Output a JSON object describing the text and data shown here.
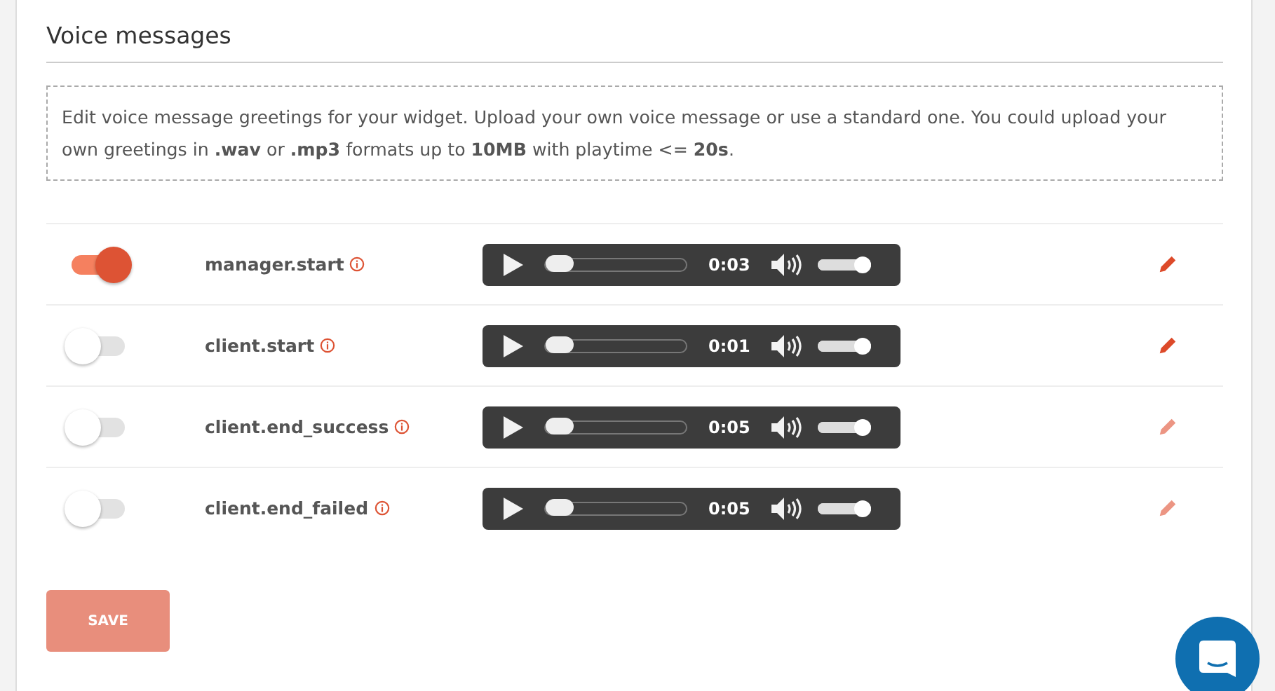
{
  "section": {
    "title": "Voice messages"
  },
  "notice": "Edit voice message greetings for your widget. Upload your own voice message or use a standard one. You could upload your own greetings in **.wav** or **.mp3** formats up to **10MB** with playtime <= **20s**.",
  "messages": [
    {
      "name": "manager.start",
      "on": true,
      "player": {
        "time": "0:03",
        "level": 0,
        "volume": {
          "level": 1
        }
      },
      "edit_disabled": false
    },
    {
      "name": "client.start",
      "on": false,
      "player": {
        "time": "0:01",
        "level": 0,
        "volume": {
          "level": 1
        }
      },
      "edit_disabled": false
    },
    {
      "name": "client.end_success",
      "on": false,
      "player": {
        "time": "0:05",
        "level": 0,
        "volume": {
          "level": 1
        }
      },
      "edit_disabled": true
    },
    {
      "name": "client.end_failed",
      "on": false,
      "player": {
        "time": "0:05",
        "level": 0,
        "volume": {
          "level": 1
        }
      },
      "edit_disabled": true
    }
  ],
  "save_button": {
    "label": "SAVE",
    "disabled": true
  }
}
